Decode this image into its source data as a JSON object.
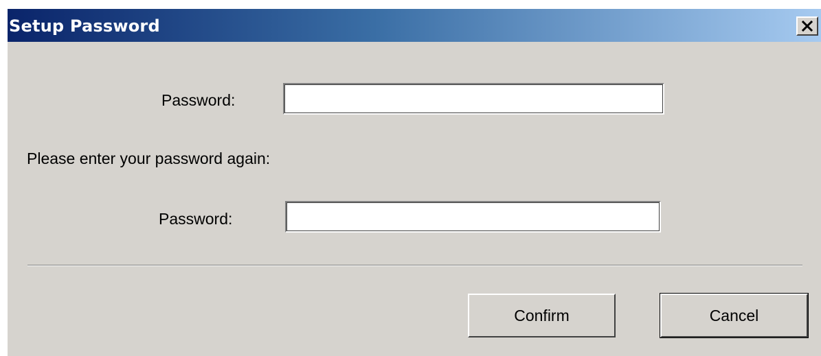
{
  "window": {
    "title": "Setup Password",
    "close_icon": "close-icon"
  },
  "form": {
    "password_label": "Password:",
    "password_value": "",
    "confirm_prompt": "Please enter your password again:",
    "password_again_label": "Password:",
    "password_again_value": ""
  },
  "buttons": {
    "confirm_label": "Confirm",
    "cancel_label": "Cancel"
  },
  "colors": {
    "titlebar_start": "#0a246a",
    "titlebar_end": "#a6caf0",
    "dialog_face": "#d6d3ce"
  }
}
